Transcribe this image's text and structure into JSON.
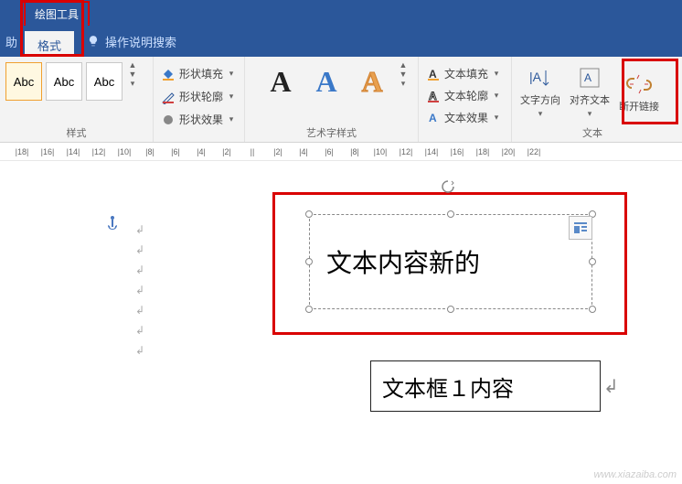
{
  "header": {
    "context_tab": "绘图工具",
    "help_tab": "助",
    "active_tab": "格式",
    "tell_me": "操作说明搜索"
  },
  "ribbon": {
    "styles": {
      "label": "样式",
      "items": [
        "Abc",
        "Abc",
        "Abc"
      ]
    },
    "shape": {
      "fill": "形状填充",
      "outline": "形状轮廓",
      "effects": "形状效果"
    },
    "wordart": {
      "label": "艺术字样式",
      "glyph": "A"
    },
    "textfx": {
      "fill": "文本填充",
      "outline": "文本轮廓",
      "effects": "文本效果"
    },
    "text": {
      "label": "文本",
      "direction": "文字方向",
      "align": "对齐文本",
      "break_link": "断开链接"
    }
  },
  "ruler": [
    "18",
    "16",
    "14",
    "12",
    "10",
    "8",
    "6",
    "4",
    "2",
    "",
    "2",
    "4",
    "6",
    "8",
    "10",
    "12",
    "14",
    "16",
    "18",
    "20",
    "22"
  ],
  "doc": {
    "textbox1": "文本内容新的",
    "textbox2": "文本框１内容"
  },
  "watermark": "www.xiazaiba.com"
}
